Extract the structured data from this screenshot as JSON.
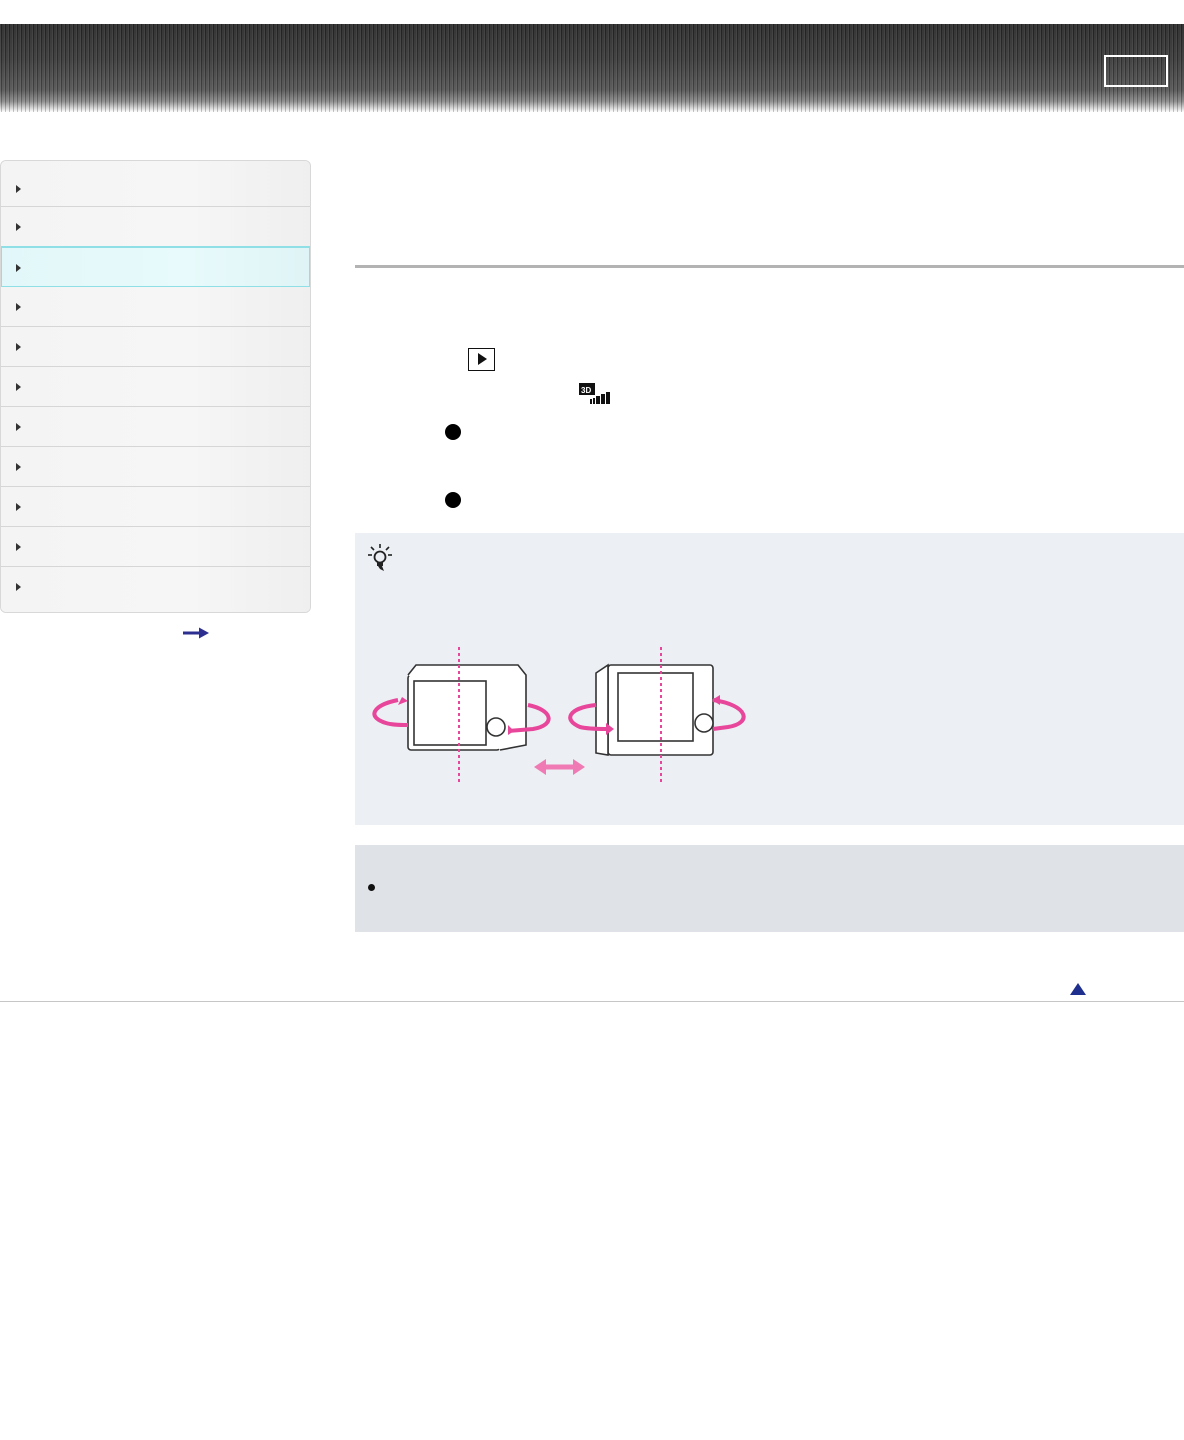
{
  "header": {
    "button_label": ""
  },
  "sidebar": {
    "items": [
      {
        "label": ""
      },
      {
        "label": ""
      },
      {
        "label": "",
        "active": true
      },
      {
        "label": ""
      },
      {
        "label": ""
      },
      {
        "label": ""
      },
      {
        "label": ""
      },
      {
        "label": ""
      },
      {
        "label": ""
      },
      {
        "label": ""
      },
      {
        "label": ""
      }
    ],
    "more_link_icon": "right-arrow-icon"
  },
  "main": {
    "page_title": "",
    "steps": [
      {
        "text": "",
        "icon": "playback-icon"
      },
      {
        "text": "",
        "icon": "3d-sweep-panorama-icon"
      }
    ],
    "bullets": [
      {
        "text": ""
      },
      {
        "text": ""
      }
    ],
    "hint": {
      "icon": "hint-bulb-icon",
      "text": "",
      "illustration": "camera-rotation-illustration"
    },
    "note": {
      "text": ""
    }
  },
  "footer": {
    "page_top_icon": "page-top-icon"
  },
  "colors": {
    "accent_pink": "#e8469b",
    "hint_bg": "#eceff4",
    "note_bg": "#dfe2e7",
    "nav_active": "#8fdfe7"
  }
}
